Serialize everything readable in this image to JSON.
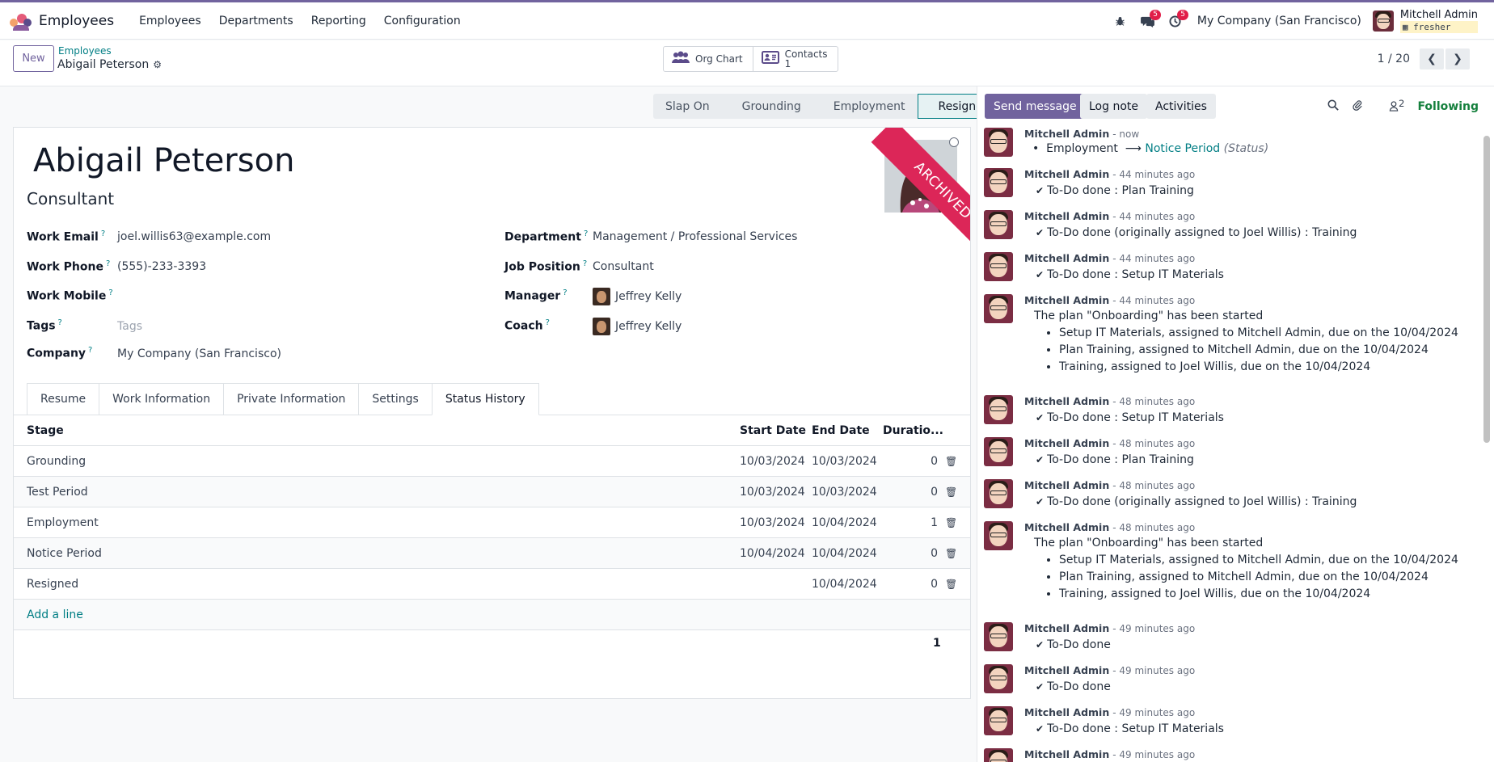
{
  "navbar": {
    "app_name": "Employees",
    "menu": [
      "Employees",
      "Departments",
      "Reporting",
      "Configuration"
    ],
    "messages_badge": "5",
    "activities_badge": "5",
    "company": "My Company (San Francisco)",
    "user_name": "Mitchell Admin",
    "user_db": "fresher"
  },
  "control": {
    "new_label": "New",
    "breadcrumb_parent": "Employees",
    "breadcrumb_current": "Abigail Peterson",
    "org_chart_label": "Org Chart",
    "contacts_label": "Contacts",
    "contacts_count": "1",
    "pager_text": "1 / 20"
  },
  "statusbar": [
    "Slap On",
    "Grounding",
    "Employment",
    "Resigned"
  ],
  "employee": {
    "name": "Abigail Peterson",
    "job_title": "Consultant",
    "ribbon": "ARCHIVED",
    "work_email_label": "Work Email",
    "work_email": "joel.willis63@example.com",
    "work_phone_label": "Work Phone",
    "work_phone": "(555)-233-3393",
    "work_mobile_label": "Work Mobile",
    "tags_label": "Tags",
    "tags_placeholder": "Tags",
    "company_label": "Company",
    "company": "My Company (San Francisco)",
    "department_label": "Department",
    "department": "Management / Professional Services",
    "job_position_label": "Job Position",
    "job_position": "Consultant",
    "manager_label": "Manager",
    "manager": "Jeffrey Kelly",
    "coach_label": "Coach",
    "coach": "Jeffrey Kelly",
    "help_mark": "?"
  },
  "tabs": [
    "Resume",
    "Work Information",
    "Private Information",
    "Settings",
    "Status History"
  ],
  "status_history": {
    "headers": {
      "stage": "Stage",
      "start": "Start Date",
      "end": "End Date",
      "duration": "Duratio..."
    },
    "rows": [
      {
        "stage": "Grounding",
        "start": "10/03/2024",
        "end": "10/03/2024",
        "duration": "0"
      },
      {
        "stage": "Test Period",
        "start": "10/03/2024",
        "end": "10/03/2024",
        "duration": "0"
      },
      {
        "stage": "Employment",
        "start": "10/03/2024",
        "end": "10/04/2024",
        "duration": "1"
      },
      {
        "stage": "Notice Period",
        "start": "10/04/2024",
        "end": "10/04/2024",
        "duration": "0"
      },
      {
        "stage": "Resigned",
        "start": "",
        "end": "10/04/2024",
        "duration": "0"
      }
    ],
    "add_line": "Add a line",
    "total": "1"
  },
  "chatter": {
    "send_message": "Send message",
    "log_note": "Log note",
    "activities": "Activities",
    "followers_count": "2",
    "following": "Following",
    "messages": [
      {
        "author": "Mitchell Admin",
        "time": "- now",
        "tracking": {
          "from": "Employment",
          "to": "Notice Period",
          "field": "(Status)"
        }
      },
      {
        "author": "Mitchell Admin",
        "time": "- 44 minutes ago",
        "text": "To-Do done : Plan Training"
      },
      {
        "author": "Mitchell Admin",
        "time": "- 44 minutes ago",
        "text": "To-Do done (originally assigned to Joel Willis) : Training"
      },
      {
        "author": "Mitchell Admin",
        "time": "- 44 minutes ago",
        "text": "To-Do done : Setup IT Materials"
      },
      {
        "author": "Mitchell Admin",
        "time": "- 44 minutes ago",
        "plan": "The plan \"Onboarding\" has been started",
        "items": [
          "Setup IT Materials, assigned to Mitchell Admin, due on the 10/04/2024",
          "Plan Training, assigned to Mitchell Admin, due on the 10/04/2024",
          "Training, assigned to Joel Willis, due on the 10/04/2024"
        ]
      },
      {
        "author": "Mitchell Admin",
        "time": "- 48 minutes ago",
        "text": "To-Do done : Setup IT Materials"
      },
      {
        "author": "Mitchell Admin",
        "time": "- 48 minutes ago",
        "text": "To-Do done : Plan Training"
      },
      {
        "author": "Mitchell Admin",
        "time": "- 48 minutes ago",
        "text": "To-Do done (originally assigned to Joel Willis) : Training"
      },
      {
        "author": "Mitchell Admin",
        "time": "- 48 minutes ago",
        "plan": "The plan \"Onboarding\" has been started",
        "items": [
          "Setup IT Materials, assigned to Mitchell Admin, due on the 10/04/2024",
          "Plan Training, assigned to Mitchell Admin, due on the 10/04/2024",
          "Training, assigned to Joel Willis, due on the 10/04/2024"
        ]
      },
      {
        "author": "Mitchell Admin",
        "time": "- 49 minutes ago",
        "text": "To-Do done"
      },
      {
        "author": "Mitchell Admin",
        "time": "- 49 minutes ago",
        "text": "To-Do done"
      },
      {
        "author": "Mitchell Admin",
        "time": "- 49 minutes ago",
        "text": "To-Do done : Setup IT Materials"
      },
      {
        "author": "Mitchell Admin",
        "time": "- 49 minutes ago",
        "text": ""
      }
    ]
  }
}
